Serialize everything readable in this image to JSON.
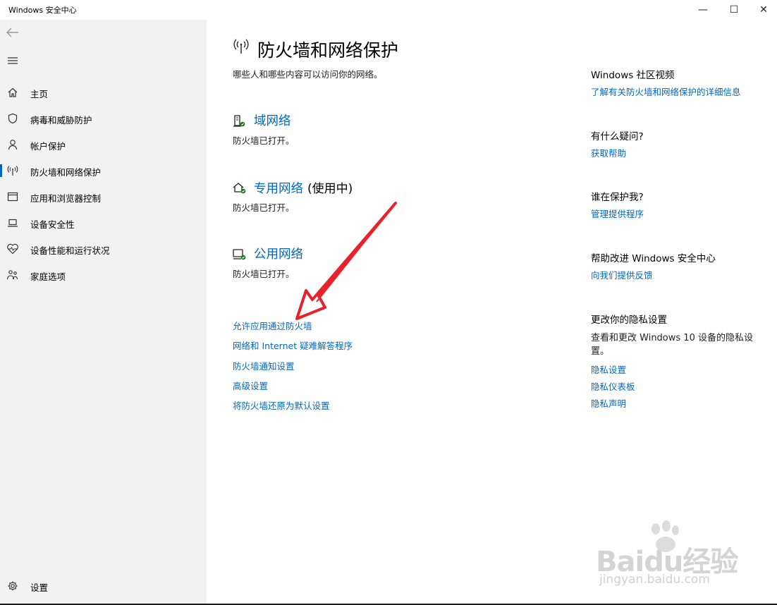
{
  "window": {
    "title": "Windows 安全中心",
    "controls": {
      "minimize": "—",
      "maximize": "☐",
      "close": "✕"
    }
  },
  "sidebar": {
    "back_icon": "back-arrow-icon",
    "menu_icon": "hamburger-menu-icon",
    "items": [
      {
        "label": "主页",
        "icon": "home-icon"
      },
      {
        "label": "病毒和威胁防护",
        "icon": "shield-icon"
      },
      {
        "label": "帐户保护",
        "icon": "person-icon"
      },
      {
        "label": "防火墙和网络保护",
        "icon": "wifi-antenna-icon",
        "active": true
      },
      {
        "label": "应用和浏览器控制",
        "icon": "app-window-icon"
      },
      {
        "label": "设备安全性",
        "icon": "laptop-icon"
      },
      {
        "label": "设备性能和运行状况",
        "icon": "heart-pulse-icon"
      },
      {
        "label": "家庭选项",
        "icon": "family-icon"
      }
    ],
    "settings": {
      "label": "设置",
      "icon": "gear-icon"
    }
  },
  "main": {
    "title": "防火墙和网络保护",
    "title_icon": "wifi-antenna-icon",
    "description": "哪些人和哪些内容可以访问你的网络。",
    "networks": [
      {
        "name": "域网络",
        "in_use": "",
        "status": "防火墙已打开。",
        "icon": "domain-network-icon"
      },
      {
        "name": "专用网络",
        "in_use": "(使用中)",
        "status": "防火墙已打开。",
        "icon": "private-network-icon"
      },
      {
        "name": "公用网络",
        "in_use": "",
        "status": "防火墙已打开。",
        "icon": "public-network-icon"
      }
    ],
    "links": [
      "允许应用通过防火墙",
      "网络和 Internet 疑难解答程序",
      "防火墙通知设置",
      "高级设置",
      "将防火墙还原为默认设置"
    ]
  },
  "right": {
    "community": {
      "heading": "Windows 社区视频",
      "link": "了解有关防火墙和网络保护的详细信息"
    },
    "questions": {
      "heading": "有什么疑问?",
      "link": "获取帮助"
    },
    "protect": {
      "heading": "谁在保护我?",
      "link": "管理提供程序"
    },
    "improve": {
      "heading": "帮助改进 Windows 安全中心",
      "link": "向我们提供反馈"
    },
    "privacy": {
      "heading": "更改你的隐私设置",
      "text": "查看和更改 Windows 10 设备的隐私设置。",
      "links": [
        "隐私设置",
        "隐私仪表板",
        "隐私声明"
      ]
    }
  },
  "watermark": {
    "brand": "Baidu经验",
    "url": "jingyan.baidu.com"
  },
  "colors": {
    "accent": "#0067c0",
    "sidebar_bg": "#f2f2f2",
    "arrow": "#e8222a"
  }
}
